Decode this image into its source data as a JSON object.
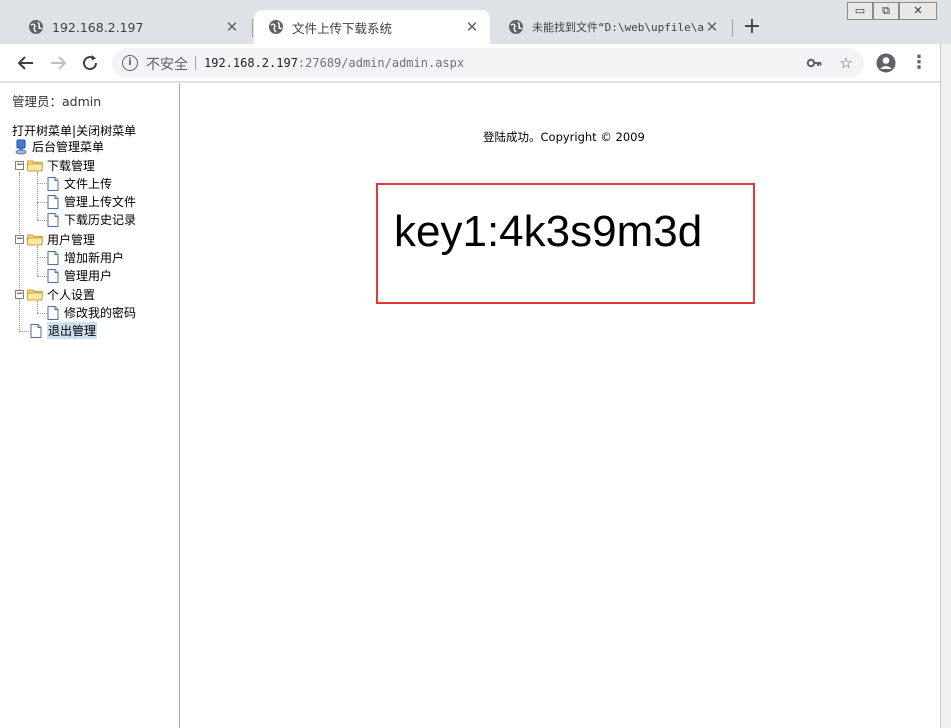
{
  "tabs": [
    {
      "title": "192.168.2.197",
      "mono": false
    },
    {
      "title": "文件上传下载系统",
      "mono": false
    },
    {
      "title": "未能找到文件“D:\\web\\upfile\\a",
      "mono": true
    }
  ],
  "window_controls": {
    "minimize": "▭",
    "restore": "⧉",
    "close": "✕"
  },
  "toolbar": {
    "insecure_label": "不安全",
    "url_host": "192.168.2.197",
    "url_rest": ":27689/admin/admin.aspx"
  },
  "sidebar": {
    "admin_label": "管理员：admin",
    "open_tree": "打开树菜单",
    "divider": "|",
    "close_tree": "关闭树菜单",
    "root": "后台管理菜单",
    "groups": [
      {
        "label": "下载管理",
        "items": [
          "文件上传",
          "管理上传文件",
          "下载历史记录"
        ]
      },
      {
        "label": "用户管理",
        "items": [
          "增加新用户",
          "管理用户"
        ]
      },
      {
        "label": "个人设置",
        "items": [
          "修改我的密码"
        ]
      }
    ],
    "logout": "退出管理"
  },
  "main": {
    "login_message": "登陆成功。Copyright © 2009",
    "key_text": "key1:4k3s9m3d"
  }
}
